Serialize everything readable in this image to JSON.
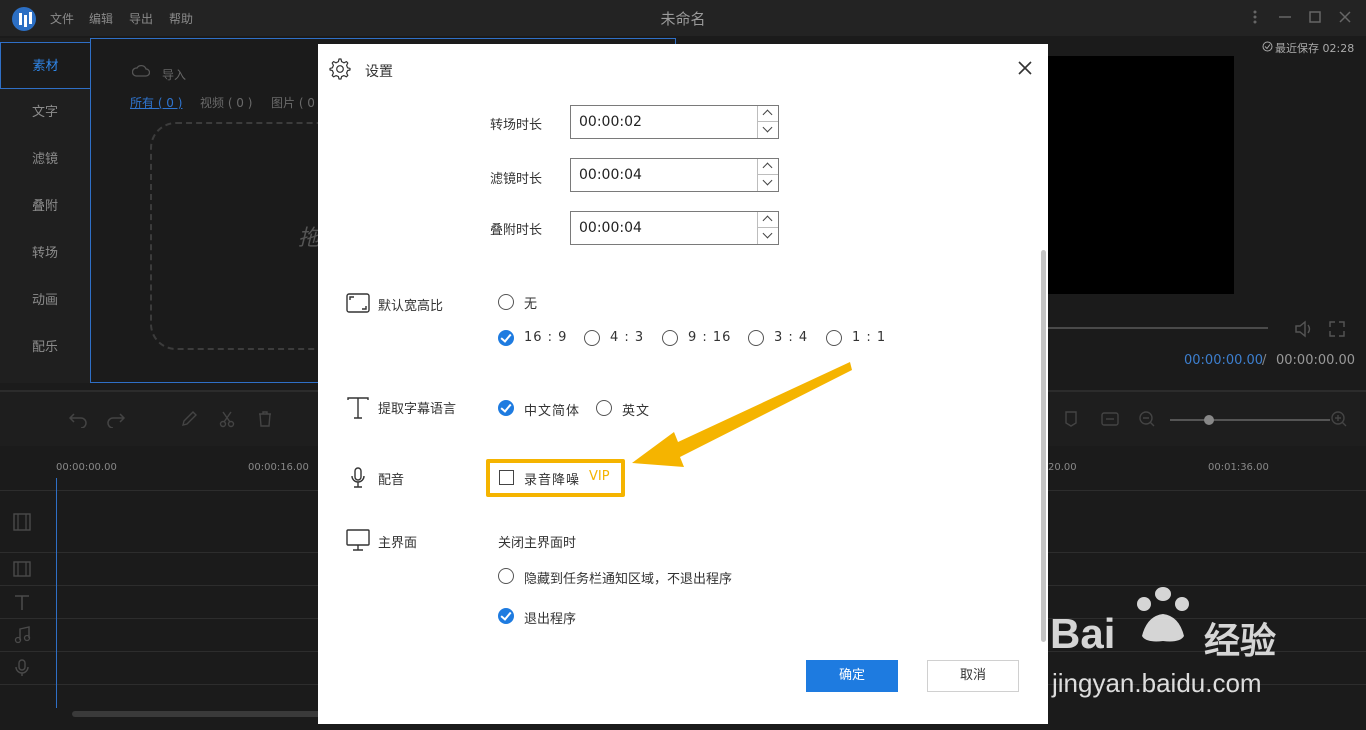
{
  "app": {
    "window_title": "未命名",
    "menu": [
      "文件",
      "编辑",
      "导出",
      "帮助"
    ],
    "save_status": "最近保存 02:28"
  },
  "left_tabs": [
    "素材",
    "文字",
    "滤镜",
    "叠附",
    "转场",
    "动画",
    "配乐"
  ],
  "media": {
    "import_label": "导入",
    "filters": [
      "所有 ( 0 )",
      "视频 ( 0 )",
      "图片 ( 0"
    ],
    "drop_hint": "拖"
  },
  "preview": {
    "time_current": "00:00:00.00",
    "time_separator": "/",
    "time_total": "00:00:00.00"
  },
  "timeline": {
    "ruler": [
      "00:00:00.00",
      "00:00:16.00",
      "20.00",
      "00:01:36.00"
    ]
  },
  "dialog": {
    "title": "设置",
    "durations": [
      {
        "label": "转场时长",
        "value": "00:00:02"
      },
      {
        "label": "滤镜时长",
        "value": "00:00:04"
      },
      {
        "label": "叠附时长",
        "value": "00:00:04"
      }
    ],
    "aspect": {
      "label": "默认宽高比",
      "none_label": "无",
      "none_selected": false,
      "options": [
        {
          "label": "16 : 9",
          "selected": true
        },
        {
          "label": "4 : 3",
          "selected": false
        },
        {
          "label": "9 : 16",
          "selected": false
        },
        {
          "label": "3 : 4",
          "selected": false
        },
        {
          "label": "1 : 1",
          "selected": false
        }
      ]
    },
    "subtitle": {
      "label": "提取字幕语言",
      "options": [
        {
          "label": "中文简体",
          "selected": true
        },
        {
          "label": "英文",
          "selected": false
        }
      ]
    },
    "dubbing": {
      "label": "配音",
      "noise_reduction_label": "录音降噪",
      "noise_reduction_checked": false,
      "vip_badge": "VIP"
    },
    "main_ui": {
      "label": "主界面",
      "on_close_label": "关闭主界面时",
      "options": [
        {
          "label": "隐藏到任务栏通知区域，不退出程序",
          "selected": false
        },
        {
          "label": "退出程序",
          "selected": true
        }
      ]
    },
    "ok_label": "确定",
    "cancel_label": "取消"
  },
  "watermark": {
    "brand": "Bai",
    "brand_cn": "经验",
    "url": "jingyan.baidu.com"
  },
  "colors": {
    "accent": "#1e7be0",
    "highlight": "#f5b400",
    "app_bg": "#1b1b1b"
  }
}
